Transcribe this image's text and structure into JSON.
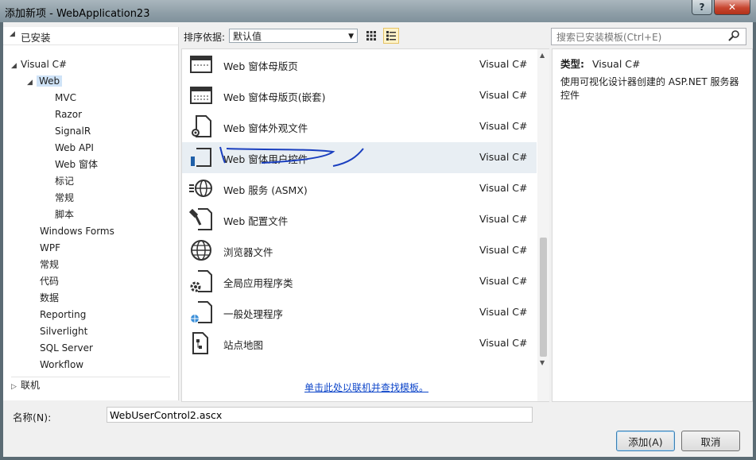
{
  "window": {
    "title": "添加新项 - WebApplication23",
    "help_glyph": "?",
    "close_glyph": "✕"
  },
  "left": {
    "installed_label": "已安装",
    "tree": [
      {
        "label": "Visual C#",
        "level": 0,
        "expanded": true
      },
      {
        "label": "Web",
        "level": 1,
        "expanded": true,
        "selected": true
      },
      {
        "label": "MVC",
        "level": 2
      },
      {
        "label": "Razor",
        "level": 2
      },
      {
        "label": "SignalR",
        "level": 2
      },
      {
        "label": "Web API",
        "level": 2
      },
      {
        "label": "Web 窗体",
        "level": 2
      },
      {
        "label": "标记",
        "level": 2
      },
      {
        "label": "常规",
        "level": 2
      },
      {
        "label": "脚本",
        "level": 2
      },
      {
        "label": "Windows Forms",
        "level": 1
      },
      {
        "label": "WPF",
        "level": 1
      },
      {
        "label": "常规",
        "level": 1
      },
      {
        "label": "代码",
        "level": 1
      },
      {
        "label": "数据",
        "level": 1
      },
      {
        "label": "Reporting",
        "level": 1
      },
      {
        "label": "Silverlight",
        "level": 1
      },
      {
        "label": "SQL Server",
        "level": 1
      },
      {
        "label": "Workflow",
        "level": 1
      }
    ],
    "online_label": "联机"
  },
  "toolbar": {
    "sort_label": "排序依据:",
    "sort_value": "默认值",
    "search_placeholder": "搜索已安装模板(Ctrl+E)"
  },
  "templates": [
    {
      "name": "Web 窗体母版页",
      "lang": "Visual C#",
      "icon": "master-page-icon"
    },
    {
      "name": "Web 窗体母版页(嵌套)",
      "lang": "Visual C#",
      "icon": "nested-master-page-icon"
    },
    {
      "name": "Web 窗体外观文件",
      "lang": "Visual C#",
      "icon": "skin-file-icon"
    },
    {
      "name": "Web 窗体用户控件",
      "lang": "Visual C#",
      "icon": "user-control-icon",
      "hover": true
    },
    {
      "name": "Web 服务 (ASMX)",
      "lang": "Visual C#",
      "icon": "web-service-icon"
    },
    {
      "name": "Web 配置文件",
      "lang": "Visual C#",
      "icon": "config-file-icon"
    },
    {
      "name": "浏览器文件",
      "lang": "Visual C#",
      "icon": "browser-file-icon"
    },
    {
      "name": "全局应用程序类",
      "lang": "Visual C#",
      "icon": "global-app-class-icon"
    },
    {
      "name": "一般处理程序",
      "lang": "Visual C#",
      "icon": "generic-handler-icon"
    },
    {
      "name": "站点地图",
      "lang": "Visual C#",
      "icon": "sitemap-icon"
    }
  ],
  "online_link": "单击此处以联机并查找模板。",
  "details": {
    "type_label": "类型:",
    "type_value": "Visual C#",
    "description": "使用可视化设计器创建的 ASP.NET 服务器控件"
  },
  "bottom": {
    "name_label": "名称(N):",
    "name_value": "WebUserControl2.ascx",
    "add_label": "添加(A)",
    "cancel_label": "取消"
  },
  "colors": {
    "selection": "#cfe3f7",
    "link": "#0d45c9",
    "annotation_ink": "#1a3fbf"
  }
}
